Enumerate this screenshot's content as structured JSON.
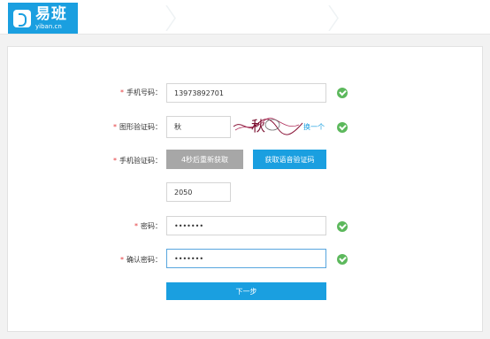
{
  "header": {
    "logo_cn": "易班",
    "logo_en": "yiban.cn",
    "steps": [
      "",
      "",
      ""
    ]
  },
  "form": {
    "phone": {
      "label": "手机号码：",
      "value": "13973892701"
    },
    "captcha": {
      "label": "图形验证码：",
      "value": "秋",
      "image_text": "秋",
      "refresh_label": "换一个"
    },
    "sms": {
      "label": "手机验证码：",
      "countdown_label": "4秒后重新获取",
      "voice_label": "获取语音验证码",
      "value": "2050"
    },
    "password": {
      "label": "密码：",
      "value": "•••••••"
    },
    "confirm": {
      "label": "确认密码：",
      "value": "•••••••"
    },
    "next_label": "下一步"
  },
  "colors": {
    "accent": "#1a9fe0",
    "success": "#5cb85c",
    "required": "#e4393c"
  }
}
